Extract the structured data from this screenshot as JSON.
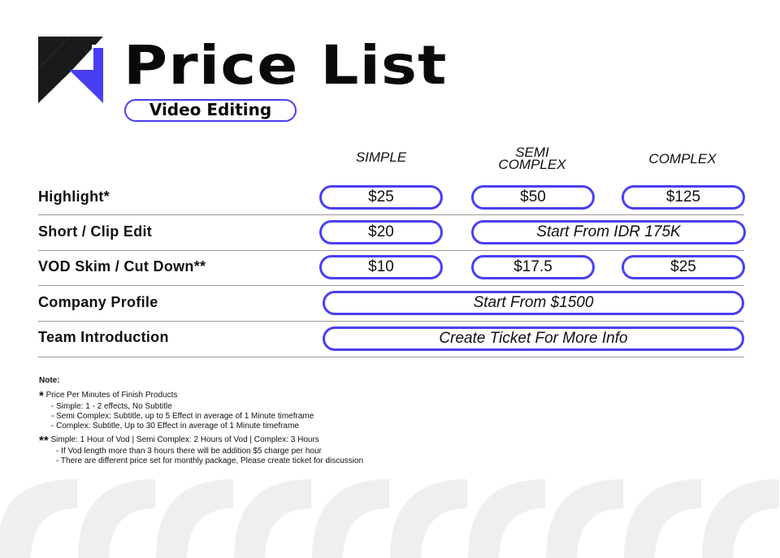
{
  "header": {
    "title": "Price List",
    "subtitle": "Video Editing",
    "logo_icon": "k-logo-icon"
  },
  "colors": {
    "accent": "#4a3ff0",
    "dark": "#1a1a1a",
    "deco": "#efefef"
  },
  "columns": {
    "simple": "SIMPLE",
    "semi_line1": "SEMI",
    "semi_line2": "COMPLEX",
    "complex": "COMPLEX"
  },
  "rows": [
    {
      "label": "Highlight*",
      "simple": "$25",
      "semi": "$50",
      "complex": "$125"
    },
    {
      "label": "Short / Clip Edit",
      "simple": "$20",
      "semi_complex_span": "Start From IDR 175K"
    },
    {
      "label": "VOD Skim / Cut Down**",
      "simple": "$10",
      "semi": "$17.5",
      "complex": "$25"
    },
    {
      "label": "Company Profile",
      "span": "Start From $1500"
    },
    {
      "label": "Team Introduction",
      "span": "Create Ticket For More Info"
    }
  ],
  "notes": {
    "heading": "Note:",
    "star1": "*",
    "star1_title": "Price Per Minutes of Finish Products",
    "star1_items": [
      "- Simple: 1 - 2 effects, No Subtitle",
      "- Semi Complex: Subtitle, up to 5 Effect in average of 1 Minute timeframe",
      "- Complex: Subtitle, Up to 30 Effect in average of 1 Minute timeframe"
    ],
    "star2": "**",
    "star2_title": "Simple: 1 Hour of Vod | Semi Complex: 2 Hours of Vod |  Complex: 3 Hours",
    "star2_items": [
      "- If Vod length more than 3 hours there will be addition $5 charge per hour",
      "- There are different price set for monthly package, Please create ticket for discussion"
    ]
  }
}
